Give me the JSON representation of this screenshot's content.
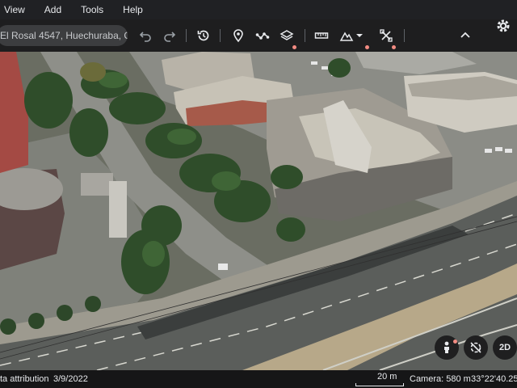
{
  "menu": {
    "items": [
      {
        "label": "View"
      },
      {
        "label": "Add"
      },
      {
        "label": "Tools"
      },
      {
        "label": "Help"
      }
    ]
  },
  "toolbar": {
    "search_value": "El Rosal 4547, Huechuraba, C",
    "icons": [
      "undo-icon",
      "redo-icon",
      "history-icon",
      "placemark-icon",
      "path-icon",
      "layers-icon",
      "ruler-icon",
      "map-style-icon",
      "measure-icon",
      "collapse-icon"
    ],
    "accent_dot_color": "#f28b82"
  },
  "controls": {
    "view_mode_label": "2D"
  },
  "status": {
    "attribution": "ta attribution",
    "date": "3/9/2022",
    "scale": "20 m",
    "camera": "Camera: 580 m",
    "coordinates": "33°22'40.25\""
  }
}
